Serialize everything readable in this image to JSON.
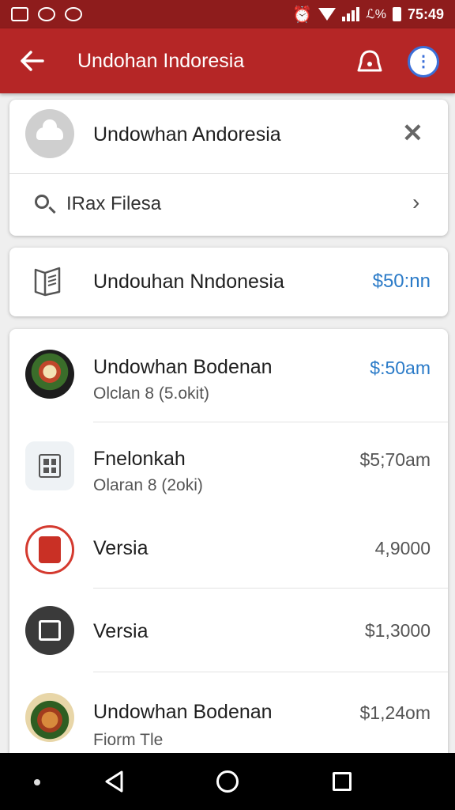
{
  "status_bar": {
    "time": "75:49",
    "battery": "ℒ%"
  },
  "app_bar": {
    "title": "Undohan Indoresia",
    "icons": [
      "back-arrow-icon",
      "bell-icon",
      "more-vert-icon"
    ],
    "color": "#b52626"
  },
  "search_card": {
    "title": "Undowhan Andoresia",
    "input_value": "IRax Filesa",
    "icons": [
      "cloud-icon",
      "close-icon",
      "search-icon",
      "chevron-right-icon"
    ]
  },
  "book_card": {
    "title": "Undouhan Nndonesia",
    "price": "$50:nn",
    "icon": "book-icon",
    "price_color": "#2b7bc8"
  },
  "items": [
    {
      "title": "Undowhan Bodenan",
      "subtitle": "Olclan 8 (5.okit)",
      "price": "$:50am",
      "icon": "food-thumbnail"
    },
    {
      "title": "Fnelonkah",
      "subtitle": "Olaran 8 (2oki)",
      "price": "$5;70am",
      "icon": "grid-file-icon"
    },
    {
      "title": "Versia",
      "subtitle": "",
      "price": "4,9000",
      "icon": "red-document-icon"
    },
    {
      "title": "Versia",
      "subtitle": "",
      "price": "$1,3000",
      "icon": "dark-document-icon"
    },
    {
      "title": "Undowhan Bodenan",
      "subtitle": "Fiorm Tle",
      "price": "$1,24om",
      "icon": "food-thumbnail"
    }
  ],
  "nav_bar": {
    "icons": [
      "dot-icon",
      "nav-back-icon",
      "nav-home-icon",
      "nav-recents-icon"
    ]
  }
}
